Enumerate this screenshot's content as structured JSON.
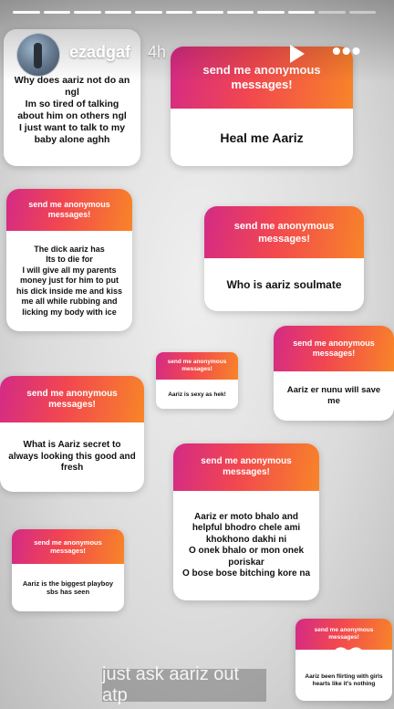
{
  "story": {
    "username": "ezadgaf",
    "time": "4h",
    "progress_segments_total": 12,
    "progress_segments_viewed": 10
  },
  "cards": [
    {
      "header": "",
      "body": "Why does aariz not do an ngl\nIm so tired of talking about him on others ngl\nI just want to talk to my baby alone aghh"
    },
    {
      "header": "send me anonymous messages!",
      "body": "Heal me Aariz"
    },
    {
      "header": "send me anonymous messages!",
      "body": "The dick aariz has\nIts to die for\nI will give all my parents money just for him to put his dick inside me and kiss me all while rubbing and licking my body with ice"
    },
    {
      "header": "send me anonymous messages!",
      "body": "Who is aariz soulmate"
    },
    {
      "header": "send me anonymous messages!",
      "body": "Aariz is sexy as hek!"
    },
    {
      "header": "send me anonymous messages!",
      "body": "Aariz er nunu will save me"
    },
    {
      "header": "send me anonymous messages!",
      "body": "What is Aariz secret to always looking this good and fresh"
    },
    {
      "header": "send me anonymous messages!",
      "body": "Aariz er moto bhalo and helpful bhodro chele ami khokhono dakhi ni\nO onek bhalo or mon onek poriskar\nO bose bose bitching kore na"
    },
    {
      "header": "send me anonymous messages!",
      "body": "Aariz is the biggest playboy sbs has seen"
    },
    {
      "header": "send me anonymous messages!",
      "body": "Aariz been flirting with girls hearts like it's nothing"
    }
  ],
  "caption": "just ask aariz out atp",
  "colors": {
    "header_gradient": [
      "#d42a86",
      "#f2474f",
      "#f88528"
    ],
    "card_body": "#ffffff"
  },
  "icons": [
    "play-icon",
    "more-options-icon",
    "heart-icon"
  ]
}
